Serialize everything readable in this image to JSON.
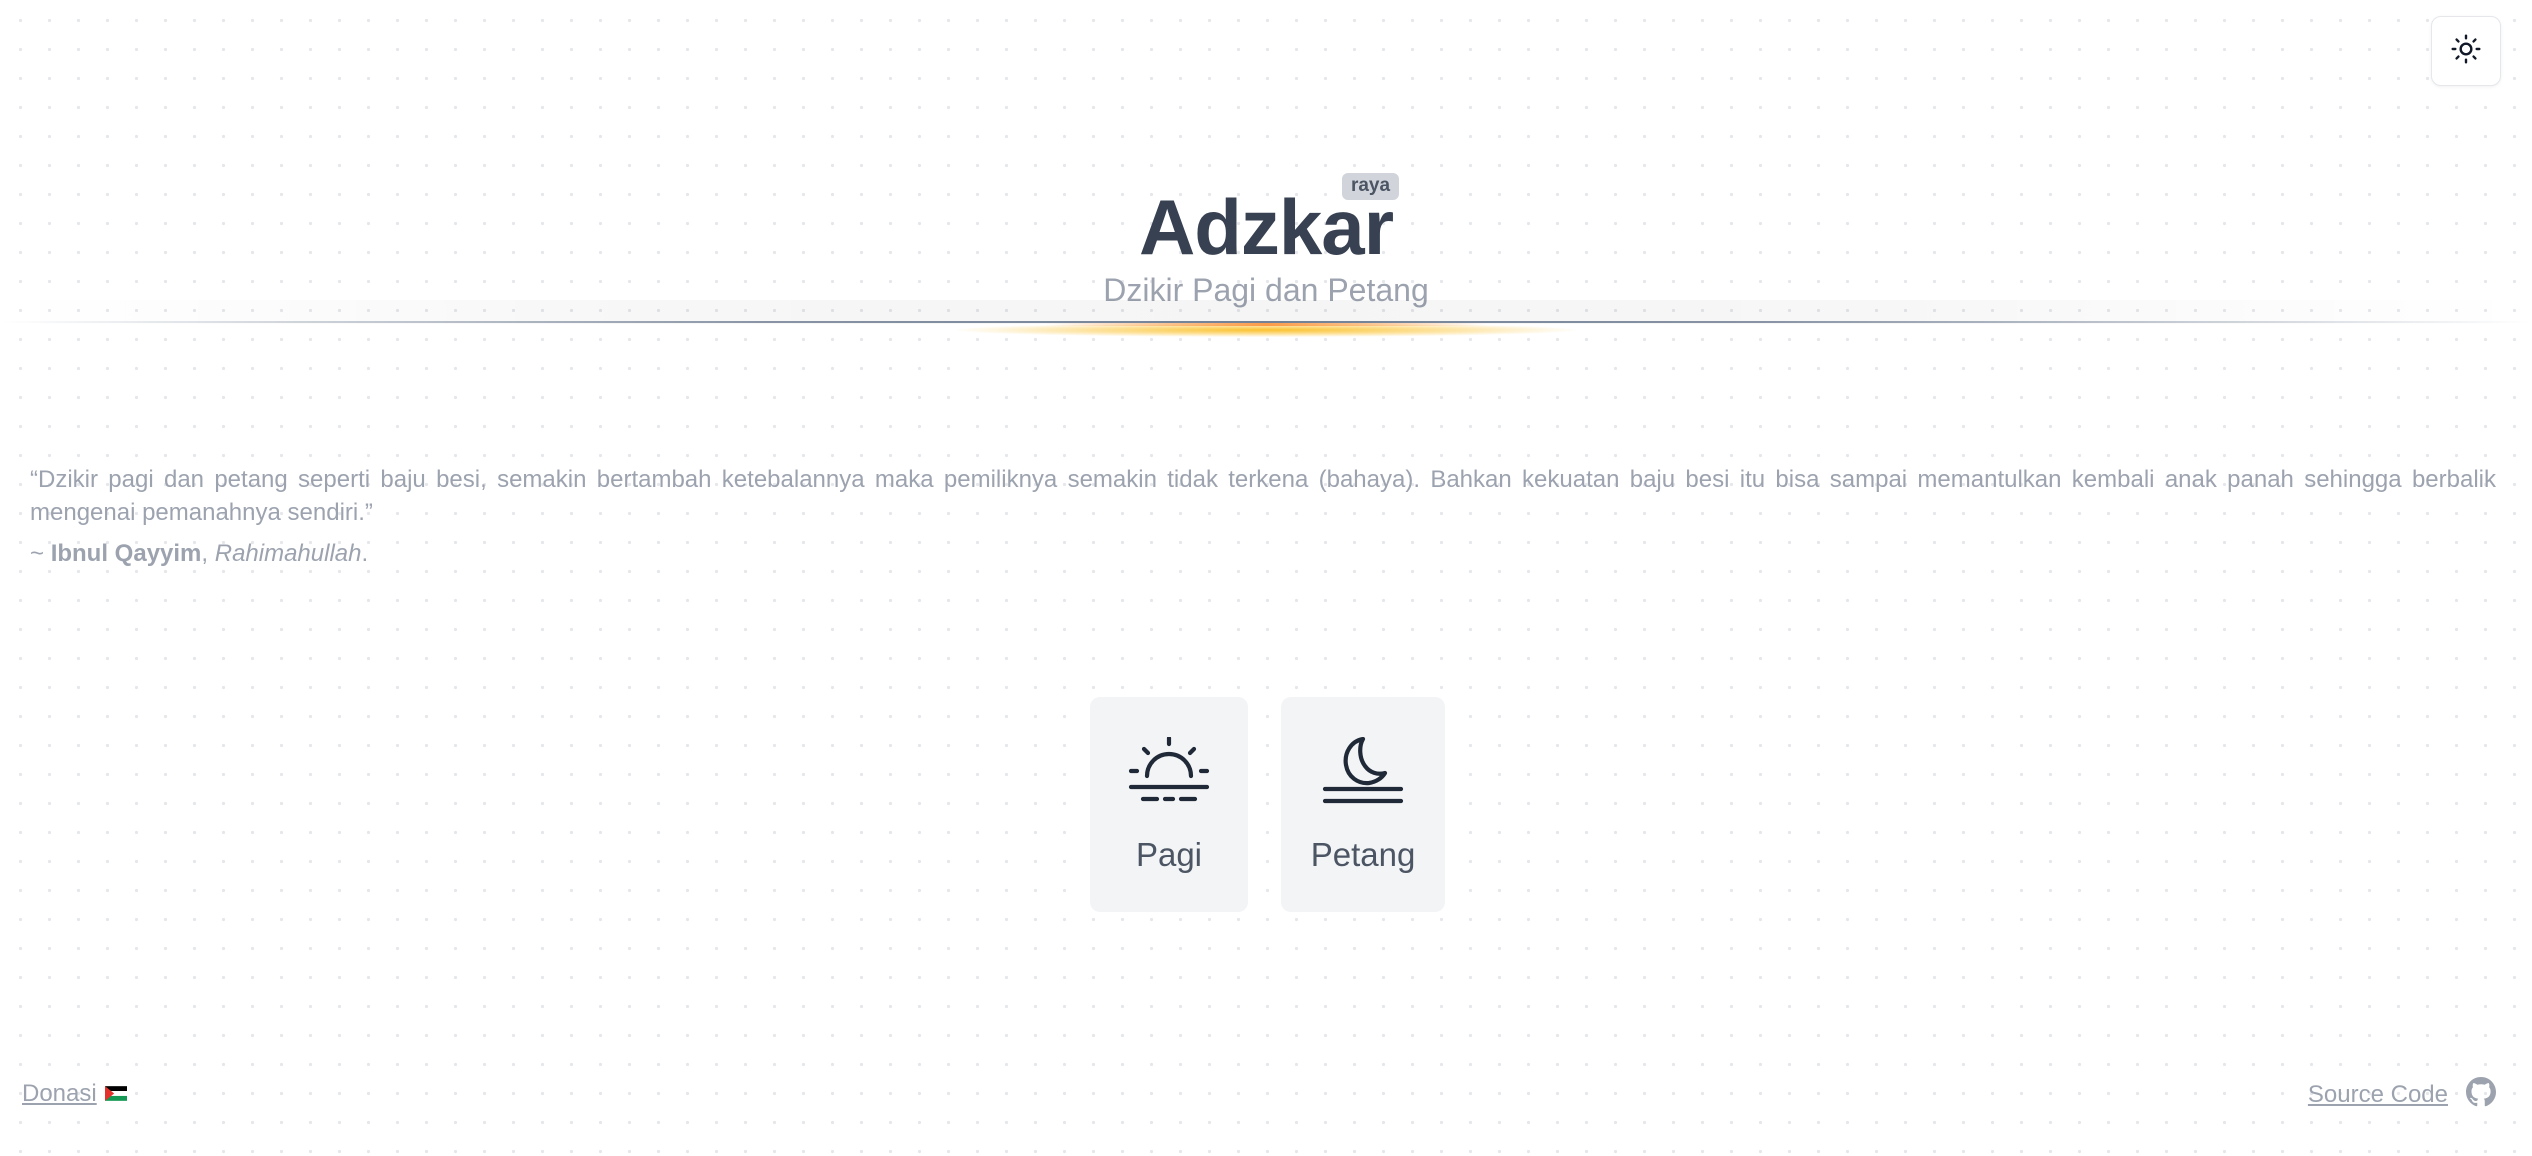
{
  "theme_toggle": {
    "icon": "sun-icon"
  },
  "header": {
    "badge": "raya",
    "title": "Adzkar",
    "subtitle": "Dzikir Pagi dan Petang"
  },
  "quote": {
    "text": "“Dzikir pagi dan petang seperti baju besi, semakin bertambah ketebalannya maka pemiliknya semakin tidak terkena (bahaya). Bahkan kekuatan baju besi itu bisa sampai memantulkan kembali anak panah sehingga berbalik mengenai pemanahnya sendiri.”",
    "author_prefix": "~ ",
    "author_name": "Ibnul Qayyim",
    "author_sep": ", ",
    "author_title": "Rahimahullah",
    "author_suffix": "."
  },
  "cards": [
    {
      "label": "Pagi",
      "icon": "sunrise-icon"
    },
    {
      "label": "Petang",
      "icon": "moon-icon"
    }
  ],
  "footer": {
    "donate_label": "Donasi",
    "donate_icon": "palestine-flag-icon",
    "source_label": "Source Code",
    "source_icon": "github-icon"
  },
  "colors": {
    "title": "#374151",
    "muted": "#9ca3af",
    "card_bg": "#f3f4f6",
    "badge_bg": "#d1d5db",
    "glow": "#fbbf24"
  }
}
